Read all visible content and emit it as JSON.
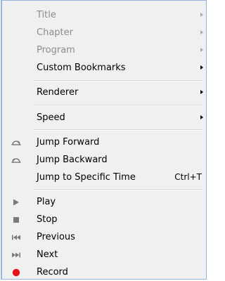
{
  "menu": {
    "title_label": "Title",
    "chapter_label": "Chapter",
    "program_label": "Program",
    "custom_bookmarks_label": "Custom Bookmarks",
    "renderer_label": "Renderer",
    "speed_label": "Speed",
    "jump_forward_label": "Jump Forward",
    "jump_backward_label": "Jump Backward",
    "jump_specific_label": "Jump to Specific Time",
    "jump_specific_shortcut": "Ctrl+T",
    "play_label": "Play",
    "stop_label": "Stop",
    "previous_label": "Previous",
    "next_label": "Next",
    "record_label": "Record"
  },
  "icons": {
    "jump_forward": "jump-forward-icon",
    "jump_backward": "jump-backward-icon",
    "play": "play-icon",
    "stop": "stop-icon",
    "previous": "previous-icon",
    "next": "next-icon",
    "record": "record-icon"
  },
  "colors": {
    "menu_background": "#f0f0f0",
    "menu_border": "#97b5dc",
    "disabled_text": "#8c8c8c",
    "record_red": "#e8121f",
    "media_icon_gray": "#7a7a7a"
  }
}
